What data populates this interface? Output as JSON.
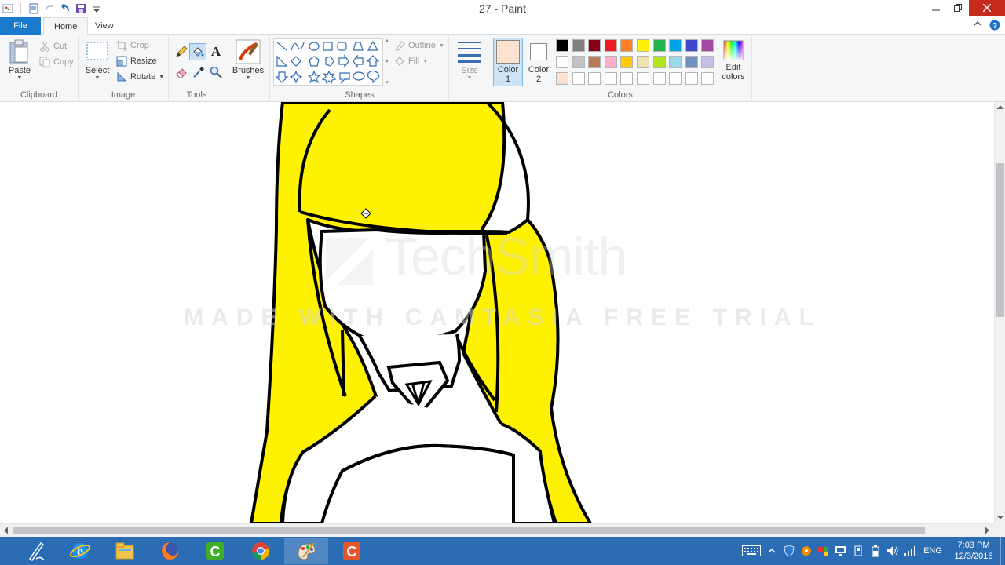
{
  "window": {
    "title": "27 - Paint"
  },
  "tabs": {
    "file": "File",
    "home": "Home",
    "view": "View"
  },
  "clipboard": {
    "paste": "Paste",
    "cut": "Cut",
    "copy": "Copy",
    "label": "Clipboard"
  },
  "image": {
    "select": "Select",
    "crop": "Crop",
    "resize": "Resize",
    "rotate": "Rotate",
    "label": "Image"
  },
  "tools": {
    "label": "Tools",
    "text_glyph": "A"
  },
  "brushes": {
    "label": "Brushes"
  },
  "shapes": {
    "outline": "Outline",
    "fill": "Fill",
    "label": "Shapes"
  },
  "size": {
    "label": "Size"
  },
  "colors": {
    "color1_label": "Color",
    "color1_num": "1",
    "color2_label": "Color",
    "color2_num": "2",
    "edit_label": "Edit",
    "edit_label2": "colors",
    "label": "Colors",
    "color1": "#fde3cf",
    "color2": "#ffffff",
    "palette_row1": [
      "#000000",
      "#7f7f7f",
      "#880015",
      "#ed1c24",
      "#ff7f27",
      "#fff200",
      "#22b14c",
      "#00a2e8",
      "#3f48cc",
      "#a349a4"
    ],
    "palette_row2": [
      "#ffffff",
      "#c3c3c3",
      "#b97a57",
      "#ffaec9",
      "#ffc90e",
      "#efe4b0",
      "#b5e61d",
      "#99d9ea",
      "#7092be",
      "#c8bfe7"
    ],
    "palette_row3": [
      "#fde3cf",
      "#ffffff",
      "#ffffff",
      "#ffffff",
      "#ffffff",
      "#ffffff",
      "#ffffff",
      "#ffffff",
      "#ffffff",
      "#ffffff"
    ]
  },
  "drawing": {
    "hair_color": "#fff200",
    "outline_color": "#000000"
  },
  "watermark": {
    "brand": "TechSmith",
    "line": "MADE WITH CAMTASIA FREE TRIAL"
  },
  "tray": {
    "language": "ENG",
    "time": "7:03 PM",
    "date": "12/3/2016"
  }
}
